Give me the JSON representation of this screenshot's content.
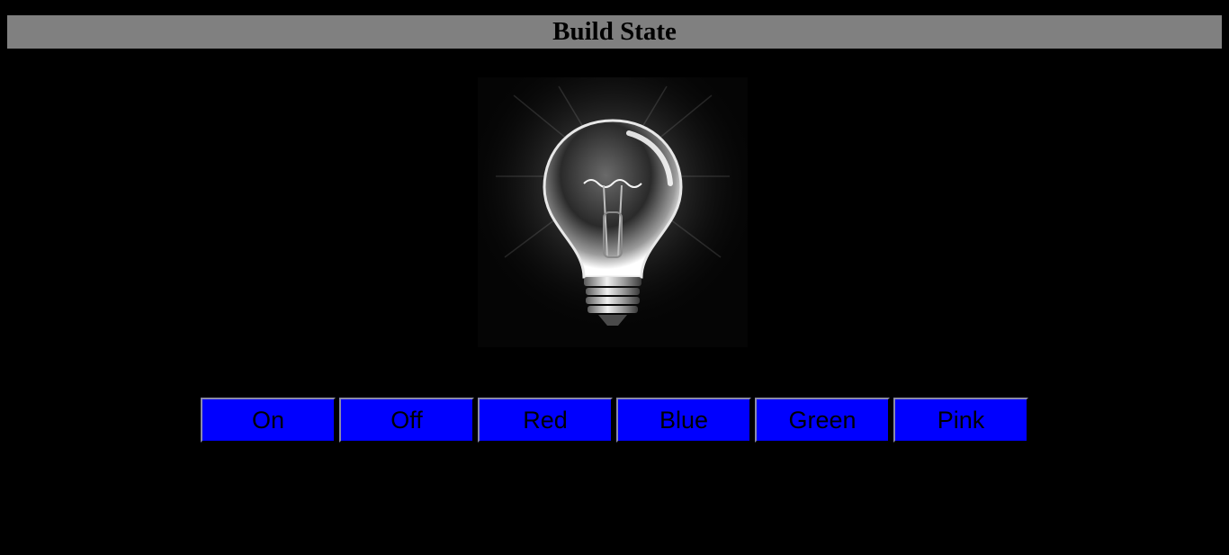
{
  "page": {
    "title": "Build State"
  },
  "bulb": {
    "icon": "lightbulb-icon"
  },
  "controls": {
    "buttons": [
      {
        "label": "On"
      },
      {
        "label": "Off"
      },
      {
        "label": "Red"
      },
      {
        "label": "Blue"
      },
      {
        "label": "Green"
      },
      {
        "label": "Pink"
      }
    ]
  },
  "colors": {
    "background": "#000000",
    "header": "#808080",
    "button": "#0000ff",
    "button_text": "#000000"
  }
}
